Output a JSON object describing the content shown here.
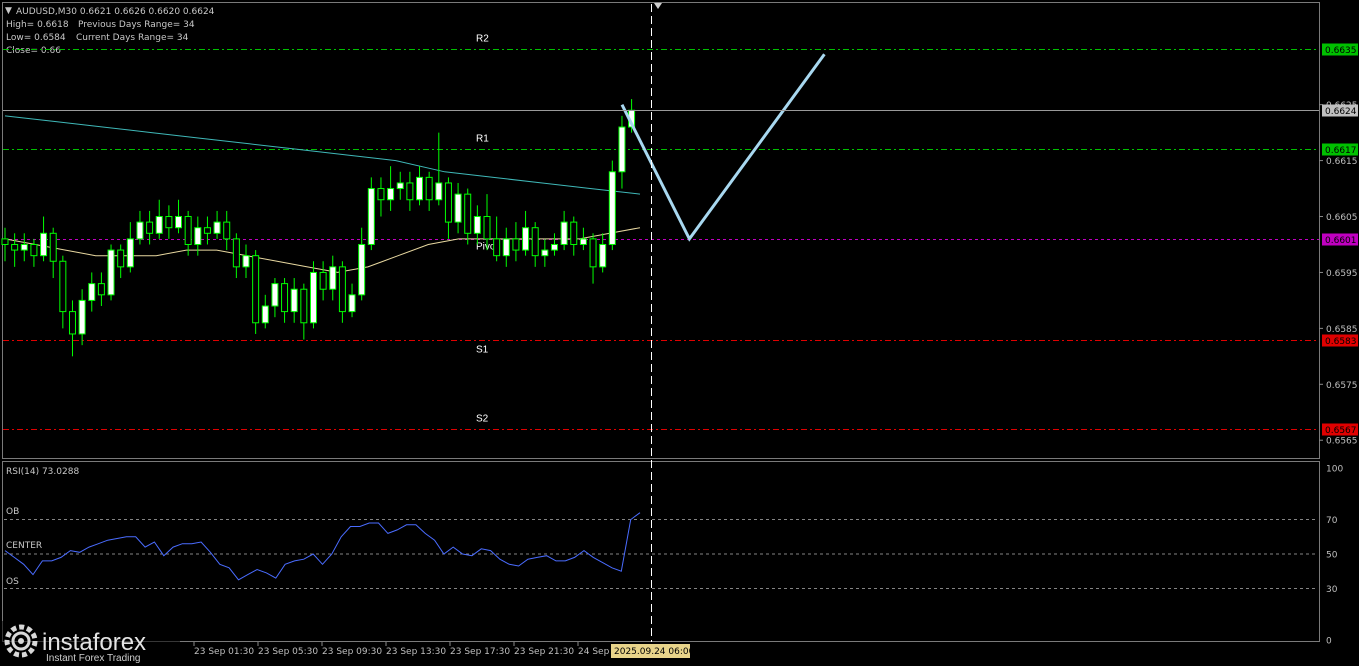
{
  "header": {
    "symbol_line": "AUDUSD,M30  0.6621 0.6626 0.6620 0.6624",
    "high_line": "High= 0.6618",
    "prev_range": "Previous Days Range= 34",
    "low_line": "Low= 0.6584",
    "curr_range": "Current Days Range= 34",
    "close_line": "Close= 0.66"
  },
  "levels": {
    "r2": {
      "label": "R2",
      "price": 0.6635,
      "price_text": "0.6635",
      "color": "#00c000"
    },
    "r1": {
      "label": "R1",
      "price": 0.6617,
      "price_text": "0.6617",
      "color": "#00c000"
    },
    "pivot": {
      "label": "Pivot",
      "price": 0.6601,
      "price_text": "0.6601",
      "color": "#c000c0"
    },
    "s1": {
      "label": "S1",
      "price": 0.6583,
      "price_text": "0.6583",
      "color": "#e00000"
    },
    "s2": {
      "label": "S2",
      "price": 0.6567,
      "price_text": "0.6567",
      "color": "#e00000"
    }
  },
  "current_price": {
    "price": 0.6624,
    "text": "0.6624",
    "color": "#c0c0c0"
  },
  "price_axis": [
    "0.6625",
    "0.6615",
    "0.6605",
    "0.6595",
    "0.6585",
    "0.6575",
    "0.6565"
  ],
  "time_axis": [
    "23 Sep 01:30",
    "23 Sep 05:30",
    "23 Sep 09:30",
    "23 Sep 13:30",
    "23 Sep 17:30",
    "23 Sep 21:30",
    "24 Sep"
  ],
  "crosshair_time": "2025.09.24 06:00",
  "rsi": {
    "title": "RSI(14) 73.0288",
    "label_ob": "OB",
    "label_center": "CENTER",
    "label_os": "OS",
    "axis": [
      "100",
      "70",
      "50",
      "30",
      "0"
    ],
    "levels": [
      70,
      50,
      30
    ],
    "values": [
      52,
      48,
      44,
      38,
      46,
      46,
      48,
      52,
      51,
      54,
      56,
      58,
      59,
      60,
      60,
      54,
      57,
      49,
      54,
      56,
      56,
      57,
      51,
      44,
      42,
      35,
      38,
      41,
      39,
      36,
      44,
      46,
      47,
      50,
      44,
      50,
      60,
      66,
      66,
      68,
      68,
      62,
      64,
      67,
      67,
      62,
      58,
      50,
      54,
      50,
      49,
      53,
      52,
      47,
      44,
      43,
      47,
      48,
      49,
      46,
      46,
      48,
      52,
      48,
      45,
      42,
      40,
      70,
      74
    ]
  },
  "chart_data": {
    "type": "candlestick",
    "symbol": "AUDUSD",
    "timeframe": "M30",
    "ylim": [
      0.6562,
      0.6643
    ],
    "projection": [
      {
        "bar": 64,
        "price": 0.6625
      },
      {
        "bar": 71,
        "price": 0.6601
      },
      {
        "bar": 85,
        "price": 0.6634
      }
    ],
    "ma_slow": [
      0.6623,
      0.6622,
      0.6621,
      0.662,
      0.6619,
      0.6618,
      0.6617,
      0.6616,
      0.6615,
      0.6613,
      0.6612,
      0.6611,
      0.661,
      0.6609
    ],
    "ma_fast": [
      0.6601,
      0.66,
      0.6599,
      0.6598,
      0.6598,
      0.6598,
      0.6599,
      0.6599,
      0.6598,
      0.6597,
      0.6596,
      0.6595,
      0.6596,
      0.6598,
      0.66,
      0.6601,
      0.6601,
      0.6601,
      0.6601,
      0.6601,
      0.6602,
      0.6603
    ],
    "candles": [
      [
        0.6601,
        0.66,
        0.6603,
        0.6597
      ],
      [
        0.66,
        0.6599,
        0.6602,
        0.6596
      ],
      [
        0.6599,
        0.66,
        0.6602,
        0.6597
      ],
      [
        0.66,
        0.6598,
        0.6601,
        0.6596
      ],
      [
        0.6598,
        0.6602,
        0.6605,
        0.6597
      ],
      [
        0.6602,
        0.6597,
        0.6603,
        0.6594
      ],
      [
        0.6597,
        0.6588,
        0.6598,
        0.6585
      ],
      [
        0.6588,
        0.6584,
        0.659,
        0.658
      ],
      [
        0.6584,
        0.659,
        0.6592,
        0.6582
      ],
      [
        0.659,
        0.6593,
        0.6595,
        0.6588
      ],
      [
        0.6593,
        0.6591,
        0.6595,
        0.6589
      ],
      [
        0.6591,
        0.6599,
        0.66,
        0.659
      ],
      [
        0.6599,
        0.6596,
        0.66,
        0.6594
      ],
      [
        0.6596,
        0.6601,
        0.6604,
        0.6595
      ],
      [
        0.6601,
        0.6604,
        0.6606,
        0.66
      ],
      [
        0.6604,
        0.6602,
        0.6606,
        0.66
      ],
      [
        0.6602,
        0.6605,
        0.6608,
        0.6601
      ],
      [
        0.6605,
        0.6603,
        0.6607,
        0.6601
      ],
      [
        0.6603,
        0.6605,
        0.6608,
        0.6602
      ],
      [
        0.6605,
        0.66,
        0.6606,
        0.6598
      ],
      [
        0.66,
        0.6603,
        0.6605,
        0.6598
      ],
      [
        0.6603,
        0.6602,
        0.6605,
        0.66
      ],
      [
        0.6602,
        0.6604,
        0.6606,
        0.6601
      ],
      [
        0.6604,
        0.6601,
        0.6606,
        0.6599
      ],
      [
        0.6601,
        0.6596,
        0.6602,
        0.6594
      ],
      [
        0.6596,
        0.6598,
        0.66,
        0.6594
      ],
      [
        0.6598,
        0.6586,
        0.6599,
        0.6584
      ],
      [
        0.6586,
        0.6589,
        0.6591,
        0.6585
      ],
      [
        0.6589,
        0.6593,
        0.6594,
        0.6587
      ],
      [
        0.6593,
        0.6588,
        0.6594,
        0.6586
      ],
      [
        0.6588,
        0.6592,
        0.6594,
        0.6586
      ],
      [
        0.6592,
        0.6586,
        0.6593,
        0.6583
      ],
      [
        0.6586,
        0.6595,
        0.6597,
        0.6585
      ],
      [
        0.6595,
        0.6592,
        0.6597,
        0.659
      ],
      [
        0.6592,
        0.6596,
        0.6598,
        0.659
      ],
      [
        0.6596,
        0.6588,
        0.6597,
        0.6586
      ],
      [
        0.6588,
        0.6591,
        0.6593,
        0.6587
      ],
      [
        0.6591,
        0.66,
        0.6603,
        0.659
      ],
      [
        0.66,
        0.661,
        0.6612,
        0.6599
      ],
      [
        0.661,
        0.6608,
        0.6612,
        0.6605
      ],
      [
        0.6608,
        0.661,
        0.6614,
        0.6606
      ],
      [
        0.661,
        0.6611,
        0.6613,
        0.6608
      ],
      [
        0.6611,
        0.6608,
        0.6613,
        0.6606
      ],
      [
        0.6608,
        0.6612,
        0.6614,
        0.6607
      ],
      [
        0.6612,
        0.6608,
        0.6613,
        0.6606
      ],
      [
        0.6608,
        0.6611,
        0.662,
        0.6607
      ],
      [
        0.6611,
        0.6604,
        0.6612,
        0.6601
      ],
      [
        0.6604,
        0.6609,
        0.6611,
        0.6602
      ],
      [
        0.6609,
        0.6602,
        0.661,
        0.66
      ],
      [
        0.6602,
        0.6605,
        0.6607,
        0.66
      ],
      [
        0.6605,
        0.6601,
        0.6609,
        0.6599
      ],
      [
        0.6601,
        0.6598,
        0.6605,
        0.6597
      ],
      [
        0.6598,
        0.6601,
        0.6603,
        0.6596
      ],
      [
        0.6601,
        0.6599,
        0.6604,
        0.6597
      ],
      [
        0.6599,
        0.6603,
        0.6606,
        0.6598
      ],
      [
        0.6603,
        0.6598,
        0.6604,
        0.6596
      ],
      [
        0.6598,
        0.6599,
        0.6601,
        0.6596
      ],
      [
        0.6599,
        0.66,
        0.6602,
        0.6598
      ],
      [
        0.66,
        0.6604,
        0.6606,
        0.6599
      ],
      [
        0.6604,
        0.66,
        0.6605,
        0.6598
      ],
      [
        0.66,
        0.6601,
        0.6603,
        0.6599
      ],
      [
        0.6601,
        0.6596,
        0.6602,
        0.6593
      ],
      [
        0.6596,
        0.66,
        0.6602,
        0.6595
      ],
      [
        0.66,
        0.6613,
        0.6615,
        0.6599
      ],
      [
        0.6613,
        0.6621,
        0.6623,
        0.661
      ],
      [
        0.6621,
        0.6624,
        0.6626,
        0.662
      ]
    ]
  },
  "brand": {
    "name": "instaforex",
    "tagline": "Instant Forex Trading",
    "icon": "instaforex-logo-icon"
  },
  "colors": {
    "bull": "#ffffff",
    "bear": "#000000",
    "wick": "#00ff00",
    "ma_slow": "#3fb8b8",
    "ma_fast": "#e8d8a0",
    "projection": "#a8d8f0",
    "rsi_line": "#4a6cff",
    "rsi_grid": "#b0b0b0",
    "frame": "#8a8a8a"
  }
}
